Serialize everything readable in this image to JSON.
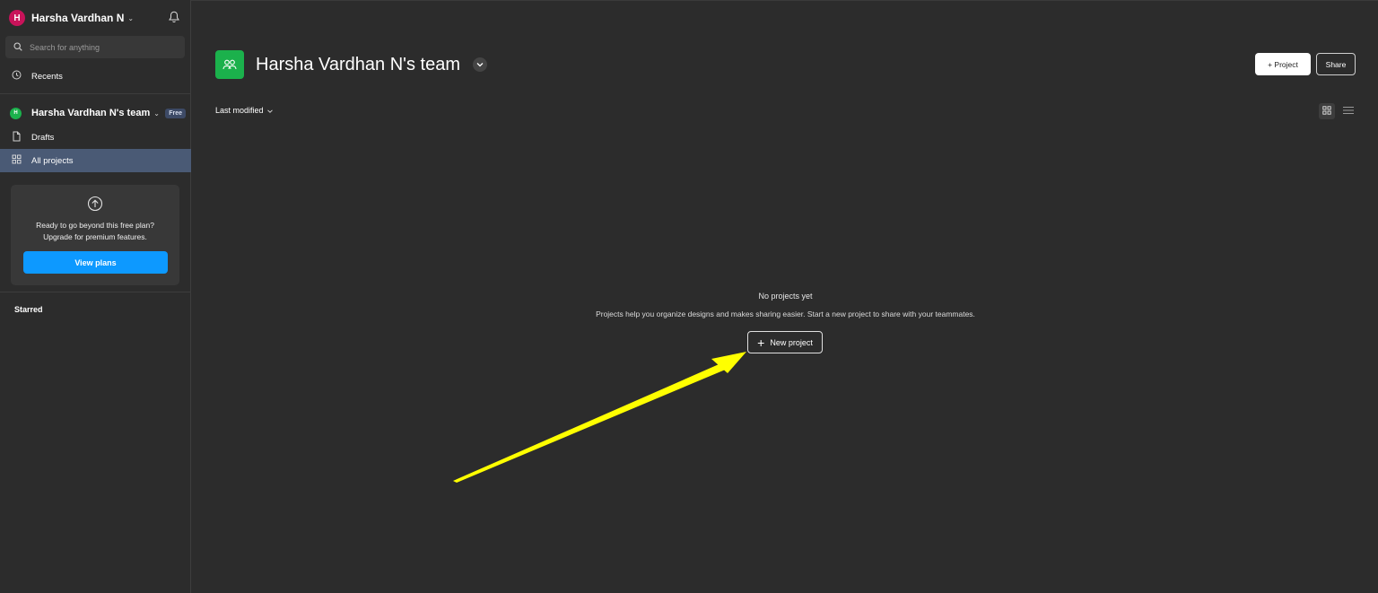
{
  "sidebar": {
    "user": {
      "initial": "H",
      "name": "Harsha Vardhan N",
      "avatar_color": "#c8135a"
    },
    "search": {
      "placeholder": "Search for anything"
    },
    "recents_label": "Recents",
    "team": {
      "initial": "H",
      "name": "Harsha Vardhan N's team",
      "badge": "Free",
      "color": "#1bb14c"
    },
    "drafts_label": "Drafts",
    "all_projects_label": "All projects",
    "upgrade": {
      "line1": "Ready to go beyond this free plan?",
      "line2": "Upgrade for premium features.",
      "button": "View plans"
    },
    "starred_label": "Starred"
  },
  "main": {
    "title": "Harsha Vardhan N's team",
    "project_button": "+ Project",
    "share_button": "Share",
    "sort_label": "Last modified",
    "empty": {
      "title": "No projects yet",
      "description": "Projects help you organize designs and makes sharing easier. Start a new project to share with your teammates.",
      "button": "New project"
    }
  },
  "colors": {
    "background": "#2c2c2c",
    "active_nav": "#4a5a75",
    "primary_button": "#0d99ff",
    "annotation_arrow": "#ffff00"
  },
  "icons": [
    "bell-icon",
    "search-icon",
    "clock-icon",
    "file-icon",
    "grid-icon",
    "upload-icon",
    "team-icon",
    "chevron-down-icon",
    "list-view-icon",
    "plus-icon",
    "annotation-arrow"
  ]
}
